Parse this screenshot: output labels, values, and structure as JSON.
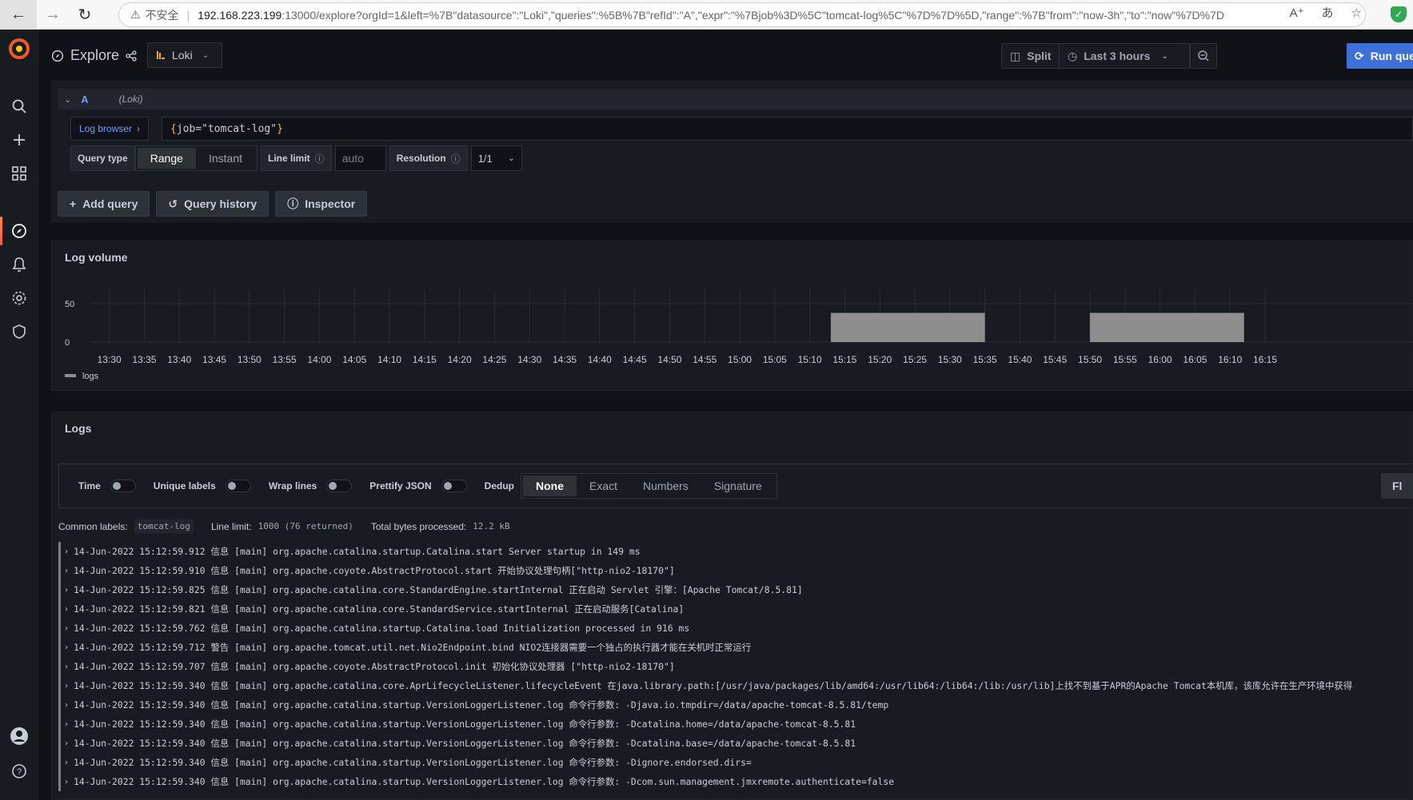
{
  "browser": {
    "insecure_label": "不安全",
    "url_host": "192.168.223.199",
    "url_rest": ":13000/explore?orgId=1&left=%7B\"datasource\":\"Loki\",\"queries\":%5B%7B\"refId\":\"A\",\"expr\":\"%7Bjob%3D%5C\"tomcat-log%5C\"%7D%7D%5D,\"range\":%7B\"from\":\"now-3h\",\"to\":\"now\"%7D%7D"
  },
  "topbar": {
    "title": "Explore",
    "datasource": "Loki",
    "split_label": "Split",
    "time_range_label": "Last 3 hours",
    "run_label": "Run query"
  },
  "query": {
    "ref_id": "A",
    "datasource_hint": "(Loki)",
    "log_browser_label": "Log browser",
    "expr_key": "job",
    "expr_value": "\"tomcat-log\"",
    "query_type_label": "Query type",
    "query_types": [
      "Range",
      "Instant"
    ],
    "line_limit_label": "Line limit",
    "line_limit_placeholder": "auto",
    "resolution_label": "Resolution",
    "resolution_value": "1/1"
  },
  "actions": {
    "add_query": "Add query",
    "query_history": "Query history",
    "inspector": "Inspector"
  },
  "colors": {
    "accent_blue": "#3d71d9",
    "bar_grey": "#8e8e8e",
    "panel_bg": "#181b1f"
  },
  "chart_data": {
    "type": "bar",
    "title": "Log volume",
    "series": [
      {
        "name": "logs"
      }
    ],
    "ylim": [
      0,
      50
    ],
    "y_ticks": [
      0,
      50
    ],
    "x_ticks": [
      "13:30",
      "13:35",
      "13:40",
      "13:45",
      "13:50",
      "13:55",
      "14:00",
      "14:05",
      "14:10",
      "14:15",
      "14:20",
      "14:25",
      "14:30",
      "14:35",
      "14:40",
      "14:45",
      "14:50",
      "14:55",
      "15:00",
      "15:05",
      "15:10",
      "15:15",
      "15:20",
      "15:25",
      "15:30",
      "15:35",
      "15:40",
      "15:45",
      "15:50",
      "15:55",
      "16:00",
      "16:05",
      "16:10",
      "16:15"
    ],
    "bars": [
      {
        "x_start": "15:13",
        "x_end": "15:35",
        "value": 38
      },
      {
        "x_start": "15:50",
        "x_end": "16:12",
        "value": 38
      }
    ],
    "grid": true,
    "legend": "bottom-left"
  },
  "logs": {
    "title": "Logs",
    "options": {
      "time": "Time",
      "unique_labels": "Unique labels",
      "wrap_lines": "Wrap lines",
      "prettify_json": "Prettify JSON",
      "dedup": "Dedup",
      "dedup_modes": [
        "None",
        "Exact",
        "Numbers",
        "Signature"
      ],
      "flip": "Fl"
    },
    "meta": {
      "common_labels_key": "Common labels:",
      "common_labels_val": "tomcat-log",
      "line_limit_key": "Line limit:",
      "line_limit_val": "1000 (76 returned)",
      "bytes_key": "Total bytes processed:",
      "bytes_val": "12.2 kB"
    },
    "rows": [
      "14-Jun-2022 15:12:59.912 信息 [main] org.apache.catalina.startup.Catalina.start Server startup in 149 ms",
      "14-Jun-2022 15:12:59.910 信息 [main] org.apache.coyote.AbstractProtocol.start 开始协议处理句柄[\"http-nio2-18170\"]",
      "14-Jun-2022 15:12:59.825 信息 [main] org.apache.catalina.core.StandardEngine.startInternal 正在启动 Servlet 引擎：[Apache Tomcat/8.5.81]",
      "14-Jun-2022 15:12:59.821 信息 [main] org.apache.catalina.core.StandardService.startInternal 正在启动服务[Catalina]",
      "14-Jun-2022 15:12:59.762 信息 [main] org.apache.catalina.startup.Catalina.load Initialization processed in 916 ms",
      "14-Jun-2022 15:12:59.712 警告 [main] org.apache.tomcat.util.net.Nio2Endpoint.bind NIO2连接器需要一个独占的执行器才能在关机时正常运行",
      "14-Jun-2022 15:12:59.707 信息 [main] org.apache.coyote.AbstractProtocol.init 初始化协议处理器 [\"http-nio2-18170\"]",
      "14-Jun-2022 15:12:59.340 信息 [main] org.apache.catalina.core.AprLifecycleListener.lifecycleEvent 在java.library.path:[/usr/java/packages/lib/amd64:/usr/lib64:/lib64:/lib:/usr/lib]上找不到基于APR的Apache Tomcat本机库，该库允许在生产环境中获得",
      "14-Jun-2022 15:12:59.340 信息 [main] org.apache.catalina.startup.VersionLoggerListener.log 命令行参数:        -Djava.io.tmpdir=/data/apache-tomcat-8.5.81/temp",
      "14-Jun-2022 15:12:59.340 信息 [main] org.apache.catalina.startup.VersionLoggerListener.log 命令行参数:        -Dcatalina.home=/data/apache-tomcat-8.5.81",
      "14-Jun-2022 15:12:59.340 信息 [main] org.apache.catalina.startup.VersionLoggerListener.log 命令行参数:        -Dcatalina.base=/data/apache-tomcat-8.5.81",
      "14-Jun-2022 15:12:59.340 信息 [main] org.apache.catalina.startup.VersionLoggerListener.log 命令行参数:        -Dignore.endorsed.dirs=",
      "14-Jun-2022 15:12:59.340 信息 [main] org.apache.catalina.startup.VersionLoggerListener.log 命令行参数:        -Dcom.sun.management.jmxremote.authenticate=false"
    ]
  }
}
